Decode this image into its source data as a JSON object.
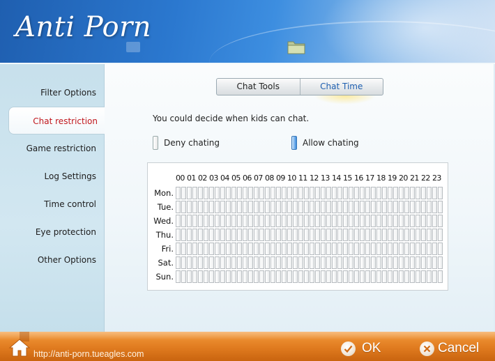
{
  "app": {
    "title": "Anti Porn",
    "website": "http://anti-porn.tueagles.com"
  },
  "sidebar": {
    "items": [
      {
        "label": "Filter Options",
        "active": false
      },
      {
        "label": "Chat restriction",
        "active": true
      },
      {
        "label": "Game restriction",
        "active": false
      },
      {
        "label": "Log Settings",
        "active": false
      },
      {
        "label": "Time control",
        "active": false
      },
      {
        "label": "Eye protection",
        "active": false
      },
      {
        "label": "Other Options",
        "active": false
      }
    ]
  },
  "tabs": [
    {
      "label": "Chat Tools",
      "active": false
    },
    {
      "label": "Chat Time",
      "active": true
    }
  ],
  "main": {
    "description": "You could decide when kids can chat.",
    "legend": {
      "deny": "Deny chating",
      "allow": "Allow chating"
    }
  },
  "schedule": {
    "hours": [
      "00",
      "01",
      "02",
      "03",
      "04",
      "05",
      "06",
      "07",
      "08",
      "09",
      "10",
      "11",
      "12",
      "13",
      "14",
      "15",
      "16",
      "17",
      "18",
      "19",
      "20",
      "21",
      "22",
      "23"
    ],
    "days": [
      "Mon.",
      "Tue.",
      "Wed.",
      "Thu.",
      "Fri.",
      "Sat.",
      "Sun."
    ],
    "allowed_slots": []
  },
  "footer": {
    "ok_label": "OK",
    "cancel_label": "Cancel"
  },
  "colors": {
    "active_nav_text": "#c0161c",
    "active_tab_text": "#1f5fb0",
    "header_blue": "#2b78cf",
    "footer_orange": "#e07b1f"
  }
}
